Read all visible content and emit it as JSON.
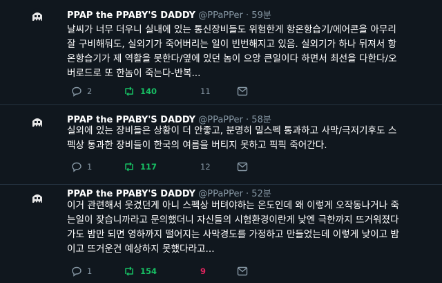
{
  "tweets": [
    {
      "author": "PPAP the PPABY'S DADDY",
      "handle": "@PPaPPer",
      "time": "59분",
      "text": "날씨가 너무 더우니 실내에 있는 통신장비들도 위험한게 항온항습기/에어콘을 아무리\n잘 구비해둬도, 실외기가 죽어버리는 일이 빈번해지고 있음. 실외기가 하나 뒤져서 항\n온항습기가 제 역활을 못한다/옆에 있던 놈이 으앙 큰일이다 하면서 최선을 다한다/오\n버로드로 또 한놈이 죽는다-반복...",
      "replies": "2",
      "retweets": "140",
      "likes": "11"
    },
    {
      "author": "PPAP the PPABY'S DADDY",
      "handle": "@PPaPPer",
      "time": "58분",
      "text": "실외에 있는 장비들은 상황이 더 안좋고, 분명히 밀스펙 통과하고 사막/극저기후도 스\n펙상 통과한 장비들이 한국의 여름을 버티지 못하고 픽픽 죽어간다.",
      "replies": "1",
      "retweets": "117",
      "likes": "12"
    },
    {
      "author": "PPAP the PPABY'S DADDY",
      "handle": "@PPaPPer",
      "time": "52분",
      "text": "이거 관련해서 웃겼던게 아니 스펙상 버텨야하는 온도인데 왜 이렇게 오작동나거나 죽\n는일이 잦습니까라고 문의했더니 자신들의 시험환경이란게 낮엔 극한까지 뜨거워졌다\n가도 밤만 되면 영하까지 떨어지는 사막경도를 가정하고 만들었는데 이렇게 낮이고 밤\n이고 뜨거운건 예상하지 못했다라고...",
      "replies": "1",
      "retweets": "154",
      "likes": "9",
      "liked": true
    }
  ],
  "colors": {
    "background": "#10171e",
    "muted": "#8899a6",
    "retweet": "#17bf63",
    "like": "#e0245e"
  }
}
